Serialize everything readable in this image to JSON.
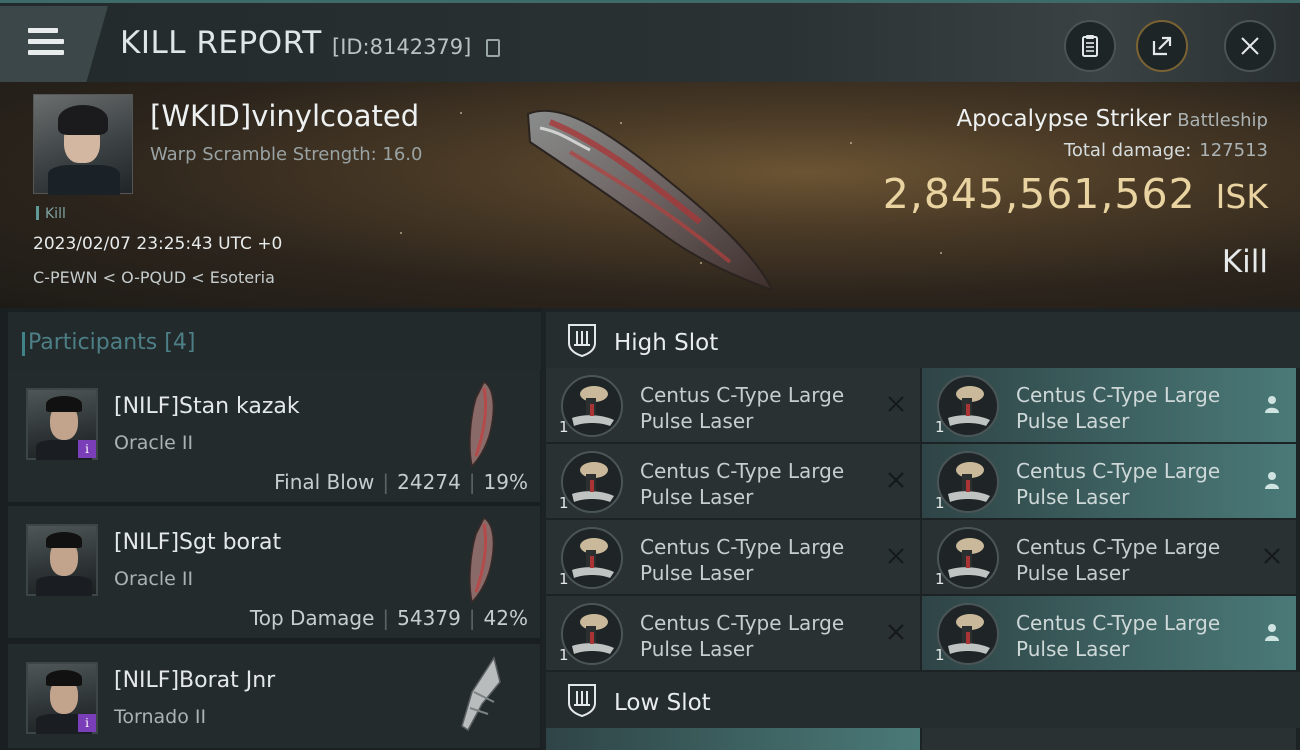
{
  "header": {
    "title": "KILL REPORT",
    "report_id": "[ID:8142379]"
  },
  "victim": {
    "name": "[WKID]vinylcoated",
    "warp_scramble": "Warp Scramble Strength: 16.0",
    "tag": "Kill",
    "date": "2023/02/07 23:25:43 UTC +0",
    "location": "C-PEWN < O-PQUD < Esoteria",
    "ship_name": "Apocalypse Striker",
    "ship_class": "Battleship",
    "total_damage_label": "Total damage:",
    "total_damage": "127513",
    "isk_value": "2,845,561,562",
    "isk_unit": "ISK",
    "result": "Kill"
  },
  "participants": {
    "label": "Participants",
    "count": "[4]",
    "rows": [
      {
        "name": "[NILF]Stan kazak",
        "ship": "Oracle II",
        "role": "Final Blow",
        "damage": "24274",
        "pct": "19%",
        "badge": "i"
      },
      {
        "name": "[NILF]Sgt borat",
        "ship": "Oracle II",
        "role": "Top Damage",
        "damage": "54379",
        "pct": "42%",
        "badge": ""
      },
      {
        "name": "[NILF]Borat Jnr",
        "ship": "Tornado II",
        "role": "",
        "damage": "",
        "pct": "",
        "badge": "i"
      }
    ]
  },
  "slots": {
    "high_label": "High Slot",
    "low_label": "Low Slot",
    "high_modules": [
      {
        "name": "Centus C-Type Large Pulse Laser",
        "qty": "1",
        "status": "destroyed"
      },
      {
        "name": "Centus C-Type Large Pulse Laser",
        "qty": "1",
        "status": "dropped"
      },
      {
        "name": "Centus C-Type Large Pulse Laser",
        "qty": "1",
        "status": "destroyed"
      },
      {
        "name": "Centus C-Type Large Pulse Laser",
        "qty": "1",
        "status": "dropped"
      },
      {
        "name": "Centus C-Type Large Pulse Laser",
        "qty": "1",
        "status": "destroyed"
      },
      {
        "name": "Centus C-Type Large Pulse Laser",
        "qty": "1",
        "status": "destroyed"
      },
      {
        "name": "Centus C-Type Large Pulse Laser",
        "qty": "1",
        "status": "destroyed"
      },
      {
        "name": "Centus C-Type Large Pulse Laser",
        "qty": "1",
        "status": "dropped"
      }
    ]
  },
  "colors": {
    "accent_teal": "#4a7a78",
    "isk_gold": "#e9d3a1",
    "badge_purple": "#7a3fb8"
  }
}
